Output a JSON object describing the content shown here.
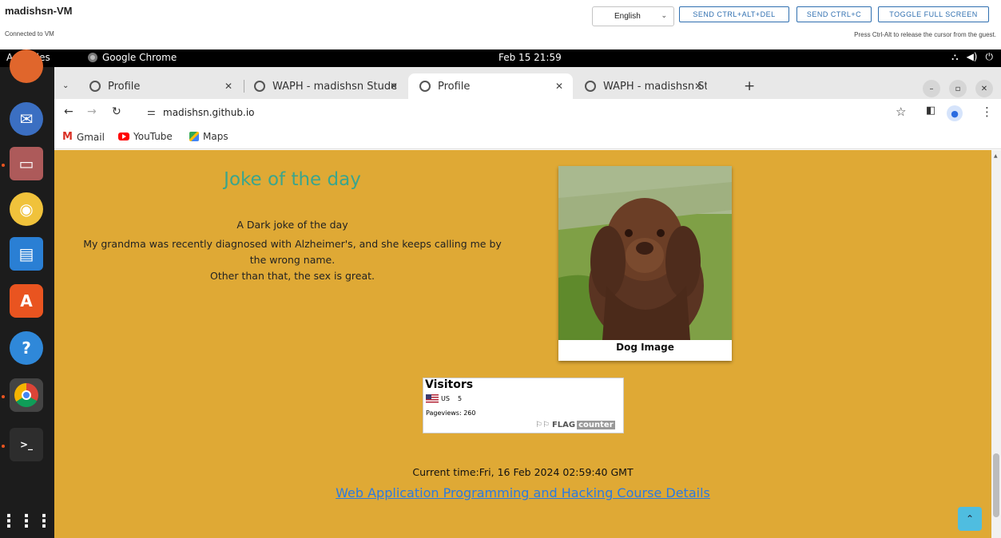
{
  "vm": {
    "title": "madishsn-VM",
    "status": "Connected to VM",
    "language": "English",
    "buttons": [
      "SEND CTRL+ALT+DEL",
      "SEND CTRL+C",
      "TOGGLE FULL SCREEN"
    ],
    "hint": "Press Ctrl-Alt to release the cursor from the guest."
  },
  "gnome": {
    "activities": "Activities",
    "app": "Google Chrome",
    "clock": "Feb 15  21:59"
  },
  "tabs": [
    {
      "label": "Profile"
    },
    {
      "label": "WAPH - madishsn Studer"
    },
    {
      "label": "Profile"
    },
    {
      "label": "WAPH - madishsn Studer"
    }
  ],
  "toolbar": {
    "url": "madishsn.github.io"
  },
  "bookmarks": {
    "gmail": "Gmail",
    "youtube": "YouTube",
    "maps": "Maps"
  },
  "page": {
    "joke_title": "Joke of the day",
    "joke_lines": [
      "A Dark joke of the day",
      "My grandma was recently diagnosed with Alzheimer's, and she keeps calling me by",
      "the wrong name.",
      "Other than that, the sex is great."
    ],
    "dog_caption": "Dog Image",
    "visitors": {
      "title": "Visitors",
      "country": "US",
      "count": "5",
      "pageviews": "Pageviews: 260",
      "brand_a": "FLAG",
      "brand_b": "counter"
    },
    "current_time": "Current time:Fri, 16 Feb 2024 02:59:40 GMT",
    "course_link": "Web Application Programming and Hacking Course Details"
  },
  "colors": {
    "page_bg": "#dfa935",
    "joke_title": "#3ba58c",
    "link": "#2a7ae2"
  }
}
